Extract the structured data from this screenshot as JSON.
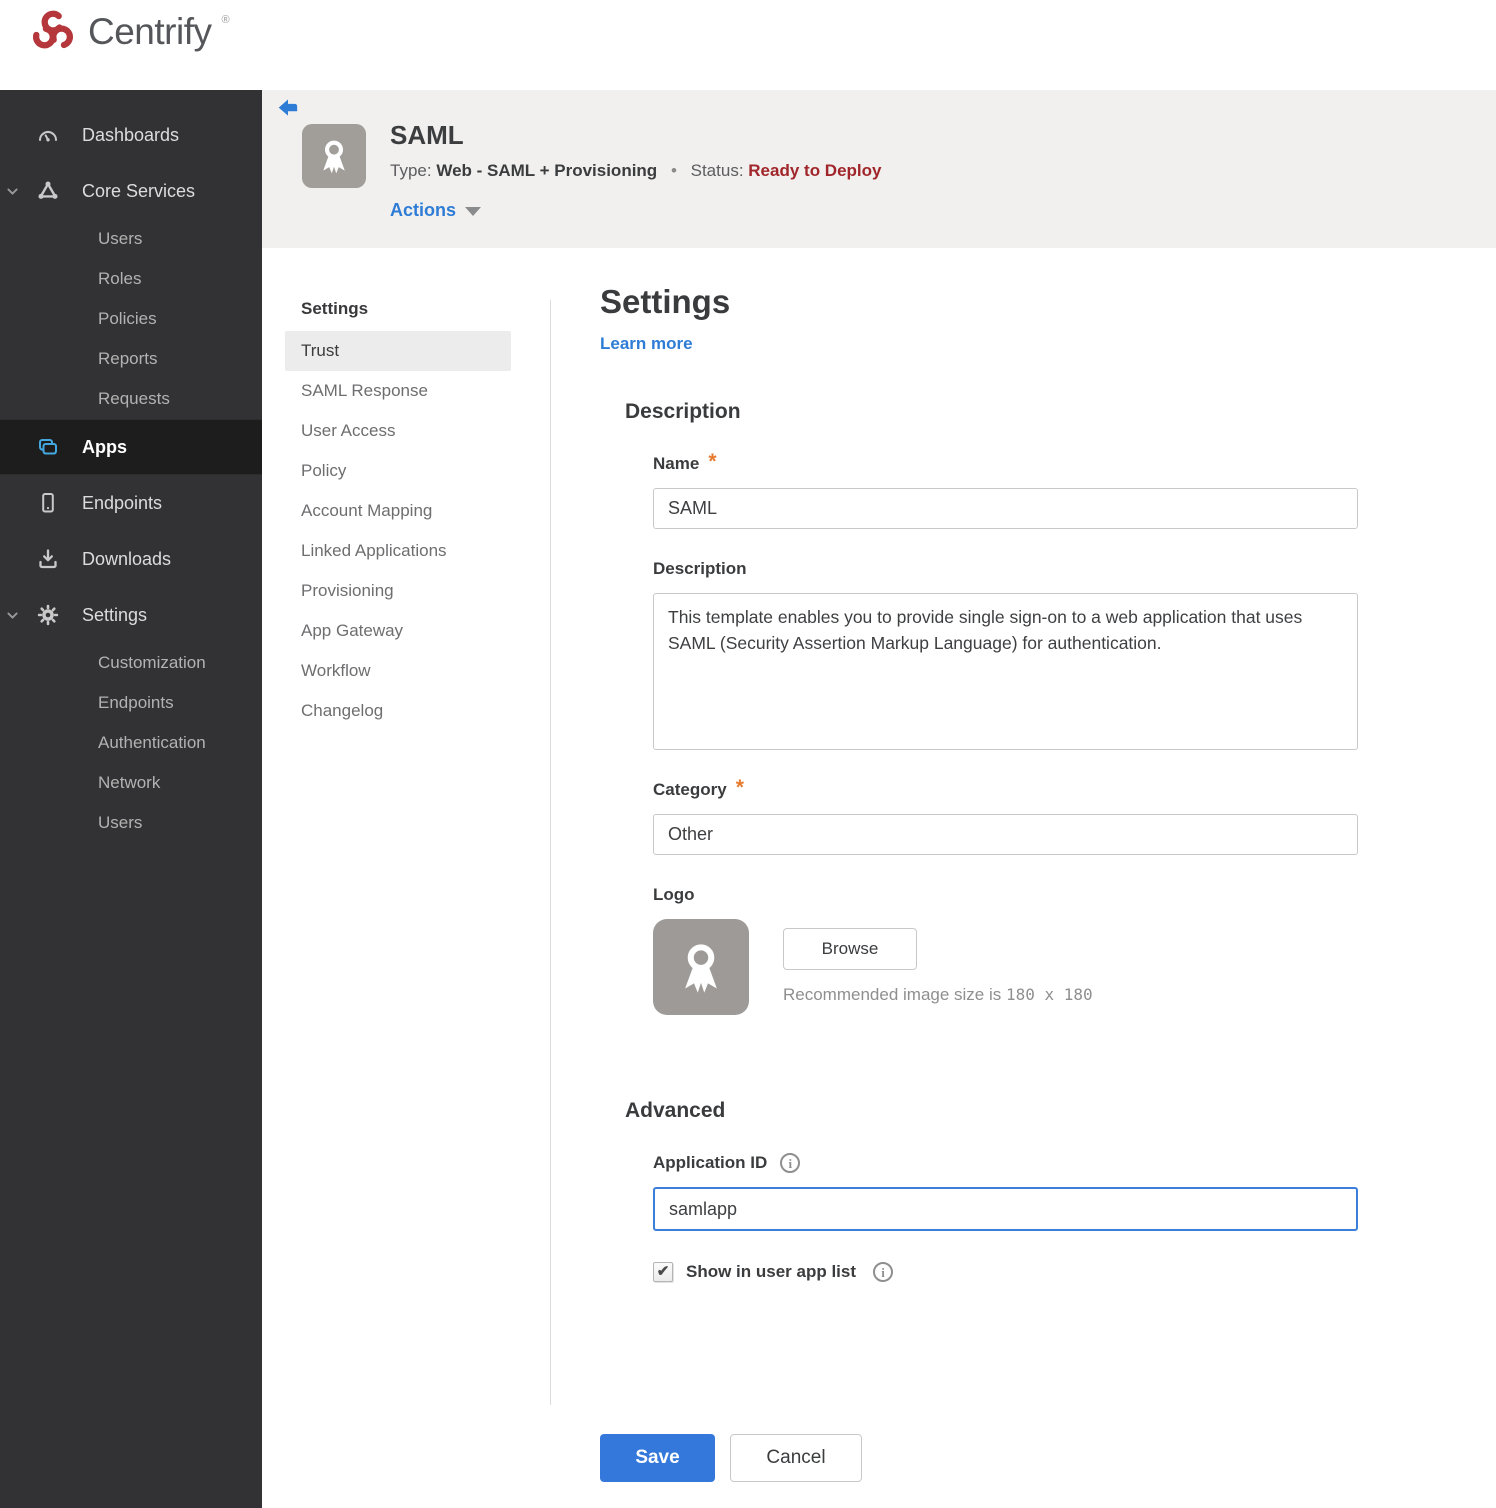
{
  "brand": {
    "name": "Centrify",
    "registered_mark": "®"
  },
  "sidebar": {
    "dashboards": "Dashboards",
    "core_services": "Core Services",
    "core_children": [
      "Users",
      "Roles",
      "Policies",
      "Reports",
      "Requests"
    ],
    "apps": "Apps",
    "endpoints": "Endpoints",
    "downloads": "Downloads",
    "settings": "Settings",
    "settings_children": [
      "Customization",
      "Endpoints",
      "Authentication",
      "Network",
      "Users"
    ]
  },
  "header": {
    "title": "SAML",
    "type_label": "Type:",
    "type_value": "Web - SAML + Provisioning",
    "separator": "•",
    "status_label": "Status:",
    "status_value": "Ready to Deploy",
    "actions_label": "Actions"
  },
  "subnav": {
    "title": "Settings",
    "active_item": "Trust",
    "items": [
      "Trust",
      "SAML Response",
      "User Access",
      "Policy",
      "Account Mapping",
      "Linked Applications",
      "Provisioning",
      "App Gateway",
      "Workflow",
      "Changelog"
    ]
  },
  "main": {
    "title": "Settings",
    "learn_more": "Learn more",
    "required_mark": "*",
    "description": {
      "heading": "Description",
      "name_label": "Name",
      "name_value": "SAML",
      "description_label": "Description",
      "description_value": "This template enables you to provide single sign-on to a web application that uses SAML (Security Assertion Markup Language) for authentication.",
      "category_label": "Category",
      "category_value": "Other",
      "logo_label": "Logo",
      "browse_label": "Browse",
      "recommended_prefix": "Recommended image size is ",
      "recommended_size": "180 x 180"
    },
    "advanced": {
      "heading": "Advanced",
      "application_id_label": "Application ID",
      "application_id_value": "samlapp",
      "show_in_user_app_list_label": "Show in user app list",
      "checkbox_checked": true
    },
    "buttons": {
      "save": "Save",
      "cancel": "Cancel"
    }
  },
  "colors": {
    "accent_blue": "#2e7cd6",
    "save_blue": "#3478db",
    "status_red": "#a1262b",
    "required_orange": "#e87a2e",
    "sidebar_bg": "#323234",
    "sidebar_active_bg": "#1d1d1e",
    "apps_icon_blue": "#43a7e0",
    "header_bg": "#f1f0ee",
    "brand_red": "#b5373c"
  }
}
